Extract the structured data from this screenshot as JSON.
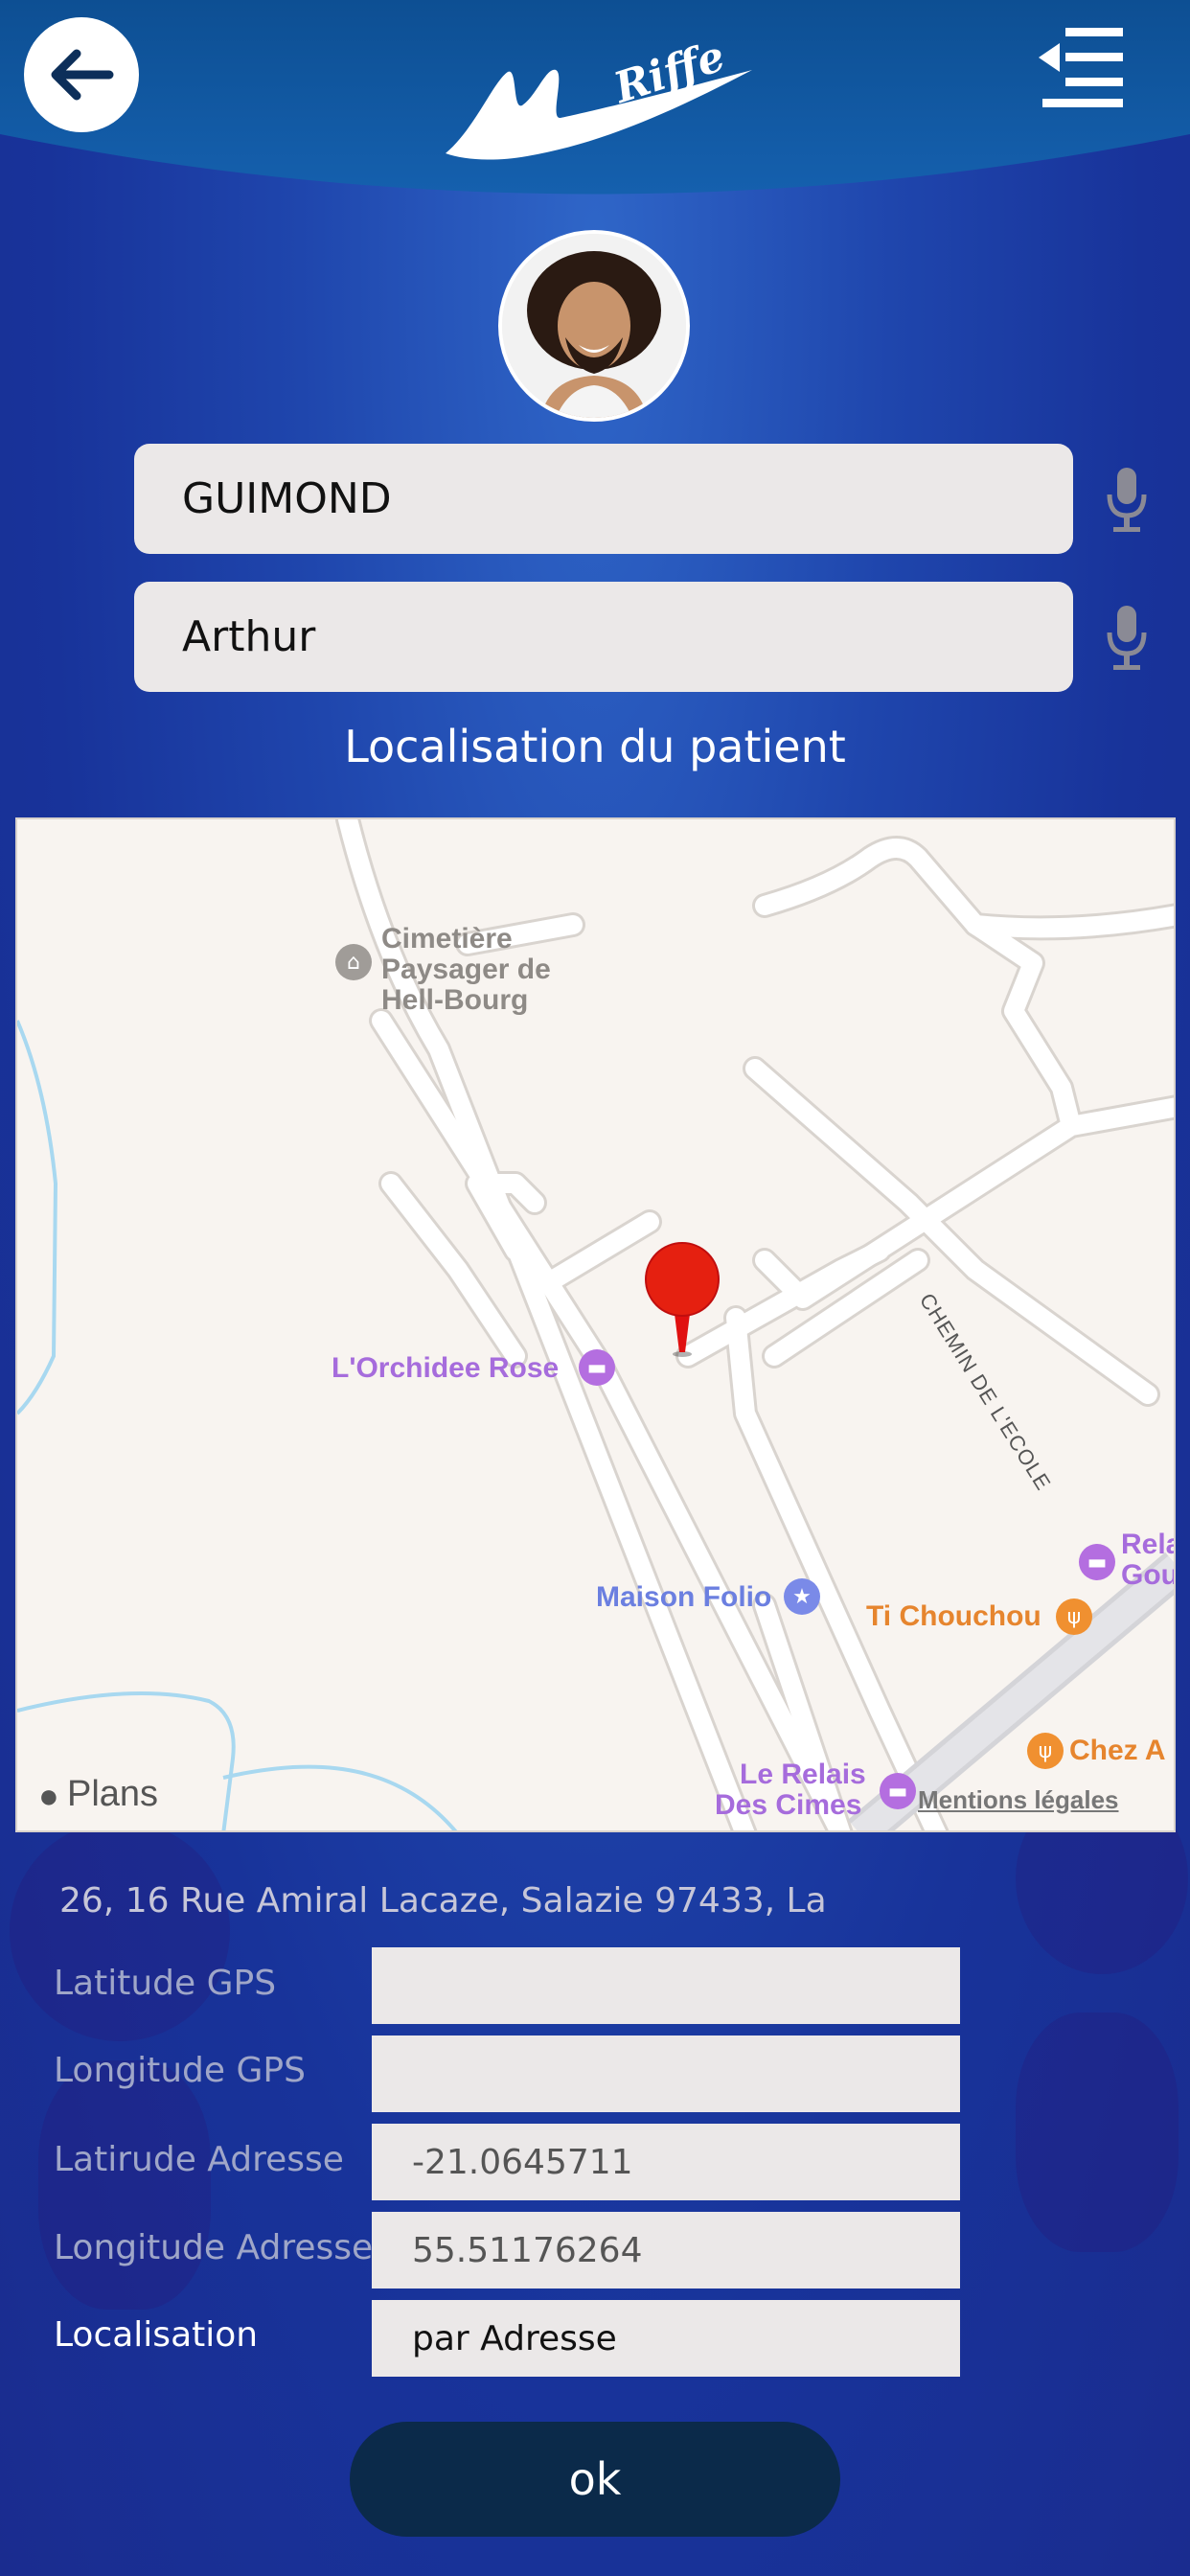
{
  "header": {
    "back_icon": "arrow-left-icon",
    "menu_icon": "menu-lines-icon",
    "logo_text": "Riffe",
    "logo_alt": "My Riffe"
  },
  "patient": {
    "last_name": "GUIMOND",
    "first_name": "Arthur",
    "mic_icon": "microphone-icon"
  },
  "location_section": {
    "title": "Localisation du patient"
  },
  "map": {
    "labels": {
      "cemetery": [
        "Cimetière",
        "Paysager de",
        "Hell-Bourg"
      ],
      "orchidee": "L'Orchidee Rose",
      "chemin": "CHEMIN DE L'ECOLE",
      "maison_folio": "Maison Folio",
      "ti_chouchou": "Ti Chouchou",
      "relais_goyaves": [
        "Rela",
        "Gou"
      ],
      "chez": "Chez A",
      "relais_cimes": [
        "Le Relais",
        "Des Cimes"
      ],
      "plans": "Plans",
      "legal": "Mentions légales"
    },
    "colors": {
      "background": "#f8f4f0",
      "road": "#ffffff",
      "water": "#a8d8f0",
      "hotel_poi": "#b46ee0",
      "food_poi": "#f09030",
      "landmark_poi": "#7a8ae8",
      "pin": "#e01010"
    }
  },
  "address": {
    "full": "26, 16 Rue Amiral Lacaze,  Salazie 97433, La"
  },
  "fields": {
    "lat_gps_label": "Latitude GPS",
    "lat_gps_value": "",
    "lon_gps_label": "Longitude GPS",
    "lon_gps_value": "",
    "lat_addr_label": "Latirude Adresse",
    "lat_addr_value": "-21.0645711",
    "lon_addr_label": "Longitude Adresse",
    "lon_addr_value": "55.51176264",
    "loc_label": "Localisation",
    "loc_value": "par Adresse"
  },
  "actions": {
    "ok_label": "ok"
  }
}
